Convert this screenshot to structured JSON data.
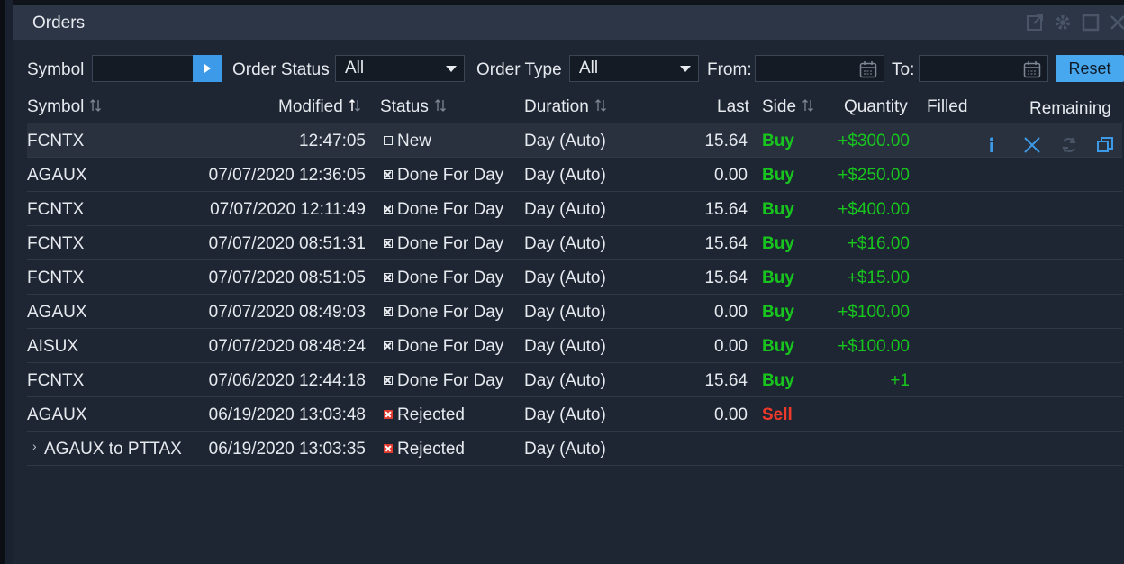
{
  "window": {
    "title": "Orders"
  },
  "icons": {
    "popout": "popout-icon",
    "settings": "gear-icon",
    "maximize": "maximize-icon",
    "close": "close-icon"
  },
  "filters": {
    "symbol_label": "Symbol",
    "symbol_value": "",
    "order_status_label": "Order Status",
    "order_status_value": "All",
    "order_type_label": "Order Type",
    "order_type_value": "All",
    "from_label": "From:",
    "from_value": "",
    "to_label": "To:",
    "to_value": "",
    "reset_label": "Reset"
  },
  "columns": {
    "symbol": "Symbol",
    "modified": "Modified",
    "status": "Status",
    "duration": "Duration",
    "last": "Last",
    "side": "Side",
    "quantity": "Quantity",
    "filled": "Filled",
    "remaining": "Remaining"
  },
  "rows": [
    {
      "symbol": "FCNTX",
      "modified": "12:47:05",
      "status": "New",
      "duration": "Day (Auto)",
      "last": "15.64",
      "side": "Buy",
      "quantity": "+$300.00"
    },
    {
      "symbol": "AGAUX",
      "modified": "07/07/2020 12:36:05",
      "status": "Done For Day",
      "duration": "Day (Auto)",
      "last": "0.00",
      "side": "Buy",
      "quantity": "+$250.00"
    },
    {
      "symbol": "FCNTX",
      "modified": "07/07/2020 12:11:49",
      "status": "Done For Day",
      "duration": "Day (Auto)",
      "last": "15.64",
      "side": "Buy",
      "quantity": "+$400.00"
    },
    {
      "symbol": "FCNTX",
      "modified": "07/07/2020 08:51:31",
      "status": "Done For Day",
      "duration": "Day (Auto)",
      "last": "15.64",
      "side": "Buy",
      "quantity": "+$16.00"
    },
    {
      "symbol": "FCNTX",
      "modified": "07/07/2020 08:51:05",
      "status": "Done For Day",
      "duration": "Day (Auto)",
      "last": "15.64",
      "side": "Buy",
      "quantity": "+$15.00"
    },
    {
      "symbol": "AGAUX",
      "modified": "07/07/2020 08:49:03",
      "status": "Done For Day",
      "duration": "Day (Auto)",
      "last": "0.00",
      "side": "Buy",
      "quantity": "+$100.00"
    },
    {
      "symbol": "AISUX",
      "modified": "07/07/2020 08:48:24",
      "status": "Done For Day",
      "duration": "Day (Auto)",
      "last": "0.00",
      "side": "Buy",
      "quantity": "+$100.00"
    },
    {
      "symbol": "FCNTX",
      "modified": "07/06/2020 12:44:18",
      "status": "Done For Day",
      "duration": "Day (Auto)",
      "last": "15.64",
      "side": "Buy",
      "quantity": "+1"
    },
    {
      "symbol": "AGAUX",
      "modified": "06/19/2020 13:03:48",
      "status": "Rejected",
      "duration": "Day (Auto)",
      "last": "0.00",
      "side": "Sell",
      "quantity": ""
    },
    {
      "symbol": "AGAUX to PTTAX",
      "modified": "06/19/2020 13:03:35",
      "status": "Rejected",
      "duration": "Day (Auto)",
      "last": "",
      "side": "",
      "quantity": ""
    }
  ],
  "row_action_icons": [
    "info-icon",
    "cancel-icon",
    "replace-icon",
    "duplicate-icon"
  ],
  "colors": {
    "buy": "#17c51e",
    "sell": "#ef3a2a",
    "accent": "#47a8ef",
    "panel": "#1f2633",
    "titlebar": "#2c3646"
  }
}
